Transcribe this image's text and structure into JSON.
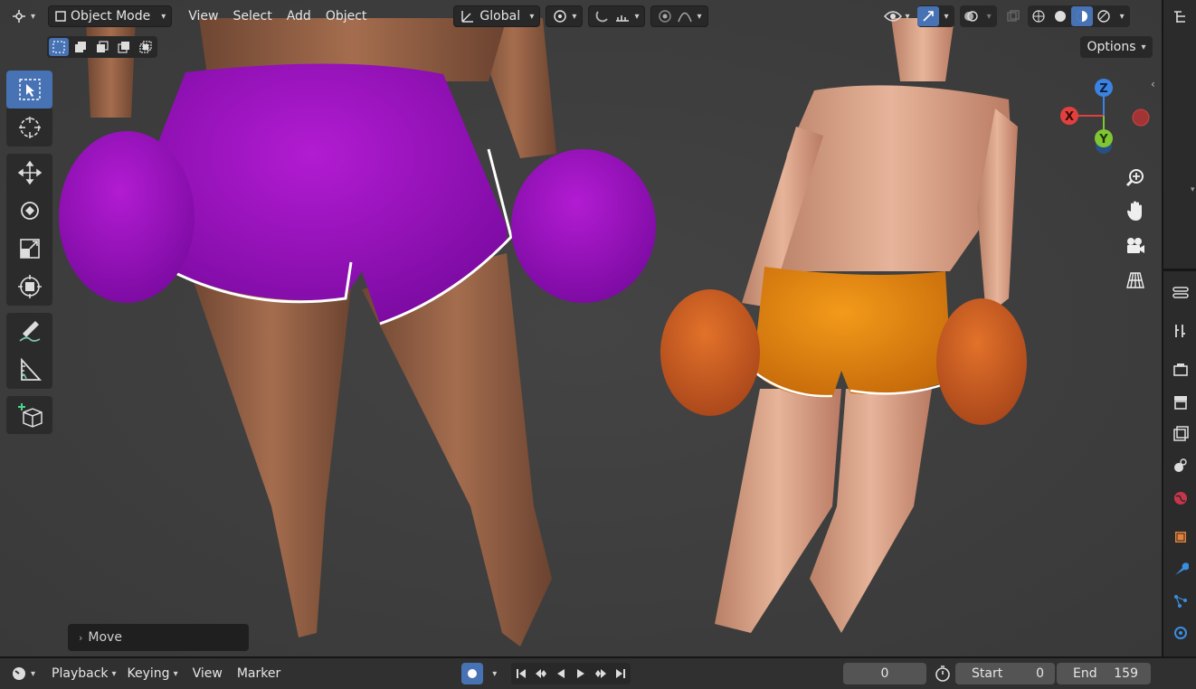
{
  "header": {
    "mode_label": "Object Mode",
    "menus": [
      "View",
      "Select",
      "Add",
      "Object"
    ],
    "orientation_label": "Global"
  },
  "options_label": "Options",
  "viewport": {
    "last_operator_label": "Move",
    "gizmo_axes": {
      "x": "X",
      "y": "Y",
      "z": "Z"
    }
  },
  "toolbar": {
    "tools": [
      "select-box",
      "cursor",
      "move",
      "rotate",
      "scale",
      "transform",
      "annotate",
      "measure",
      "add-cube"
    ],
    "active": "select-box"
  },
  "timeline": {
    "menus": [
      "Playback",
      "Keying",
      "View",
      "Marker"
    ],
    "current_frame": "0",
    "start_label": "Start",
    "start_value": "0",
    "end_label": "End",
    "end_value": "159"
  },
  "colors": {
    "accent": "#4772b3",
    "viewport_bg": "#3d3d3d",
    "axis_x": "#e0413f",
    "axis_y": "#80c634",
    "axis_z": "#3a83e0"
  }
}
